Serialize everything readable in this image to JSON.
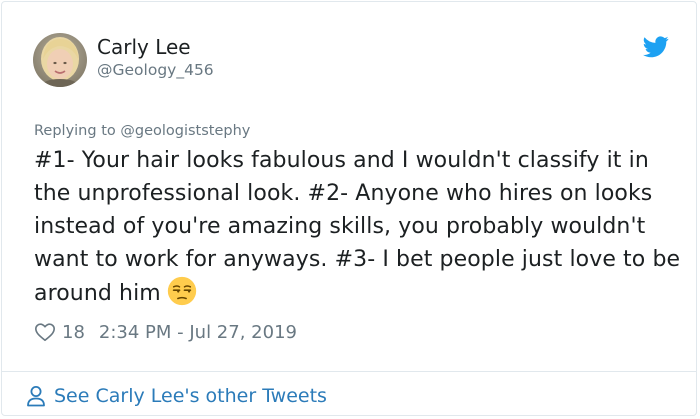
{
  "author": {
    "name": "Carly Lee",
    "handle": "@Geology_456"
  },
  "reply_context": {
    "prefix": "Replying to ",
    "mention": "@geologiststephy"
  },
  "tweet": {
    "text": "#1- Your hair looks fabulous and I wouldn't classify it in the unprofessional look. #2- Anyone who hires on looks instead of you're amazing skills, you probably wouldn't want to work for anyways. #3- I bet people just love to be around him",
    "emoji": "unamused-face-emoji"
  },
  "meta": {
    "likes": "18",
    "timestamp": "2:34 PM - Jul 27, 2019",
    "heart_icon": "heart-icon"
  },
  "footer": {
    "link_label": "See Carly Lee's other Tweets",
    "icon": "person-icon"
  },
  "colors": {
    "text": "#1c2022",
    "muted": "#697882",
    "link": "#2b7bb9",
    "twitter_blue": "#1da1f2",
    "border": "#e1e8ed"
  }
}
